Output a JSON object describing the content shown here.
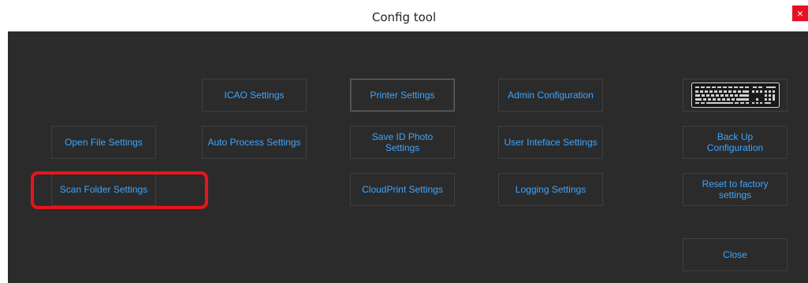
{
  "window": {
    "title": "Config tool",
    "close_glyph": "×"
  },
  "buttons": {
    "icao": "ICAO Settings",
    "printer": "Printer Settings",
    "admin": "Admin Configuration",
    "open_file": "Open File Settings",
    "auto_process": "Auto Process Settings",
    "save_id_photo": "Save ID Photo Settings",
    "user_interface": "User Inteface Settings",
    "backup": "Back Up Configuration",
    "scan_folder": "Scan Folder Settings",
    "cloudprint": "CloudPrint Settings",
    "logging": "Logging Settings",
    "reset": "Reset to factory settings",
    "close": "Close"
  },
  "icons": {
    "keyboard": "keyboard-icon"
  },
  "colors": {
    "accent_text": "#3ea6ff",
    "background": "#2b2b2b",
    "highlight": "#e8141b",
    "close_button": "#e81123"
  }
}
